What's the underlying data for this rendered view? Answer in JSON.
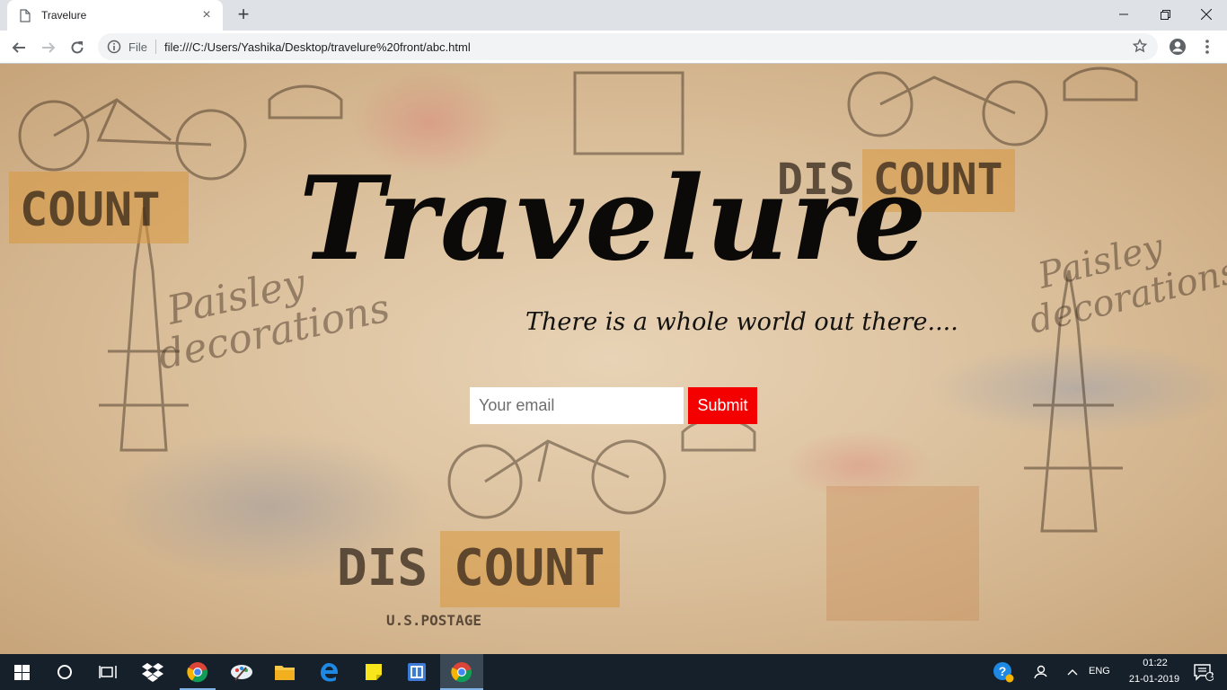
{
  "browser": {
    "tab_title": "Travelure",
    "tab_close": "×",
    "new_tab": "+",
    "scheme_label": "File",
    "url": "file:///C:/Users/Yashika/Desktop/travelure%20front/abc.html"
  },
  "page": {
    "title": "Travelure",
    "tagline": "There is a whole world out there....",
    "email_placeholder": "Your email",
    "submit_label": "Submit"
  },
  "taskbar": {
    "language": "ENG",
    "time": "01:22",
    "date": "21-01-2019",
    "notification_count": "1"
  },
  "colors": {
    "submit_bg": "#f50000",
    "taskbar_bg": "#16202a",
    "chrome_bg": "#dee1e6"
  }
}
